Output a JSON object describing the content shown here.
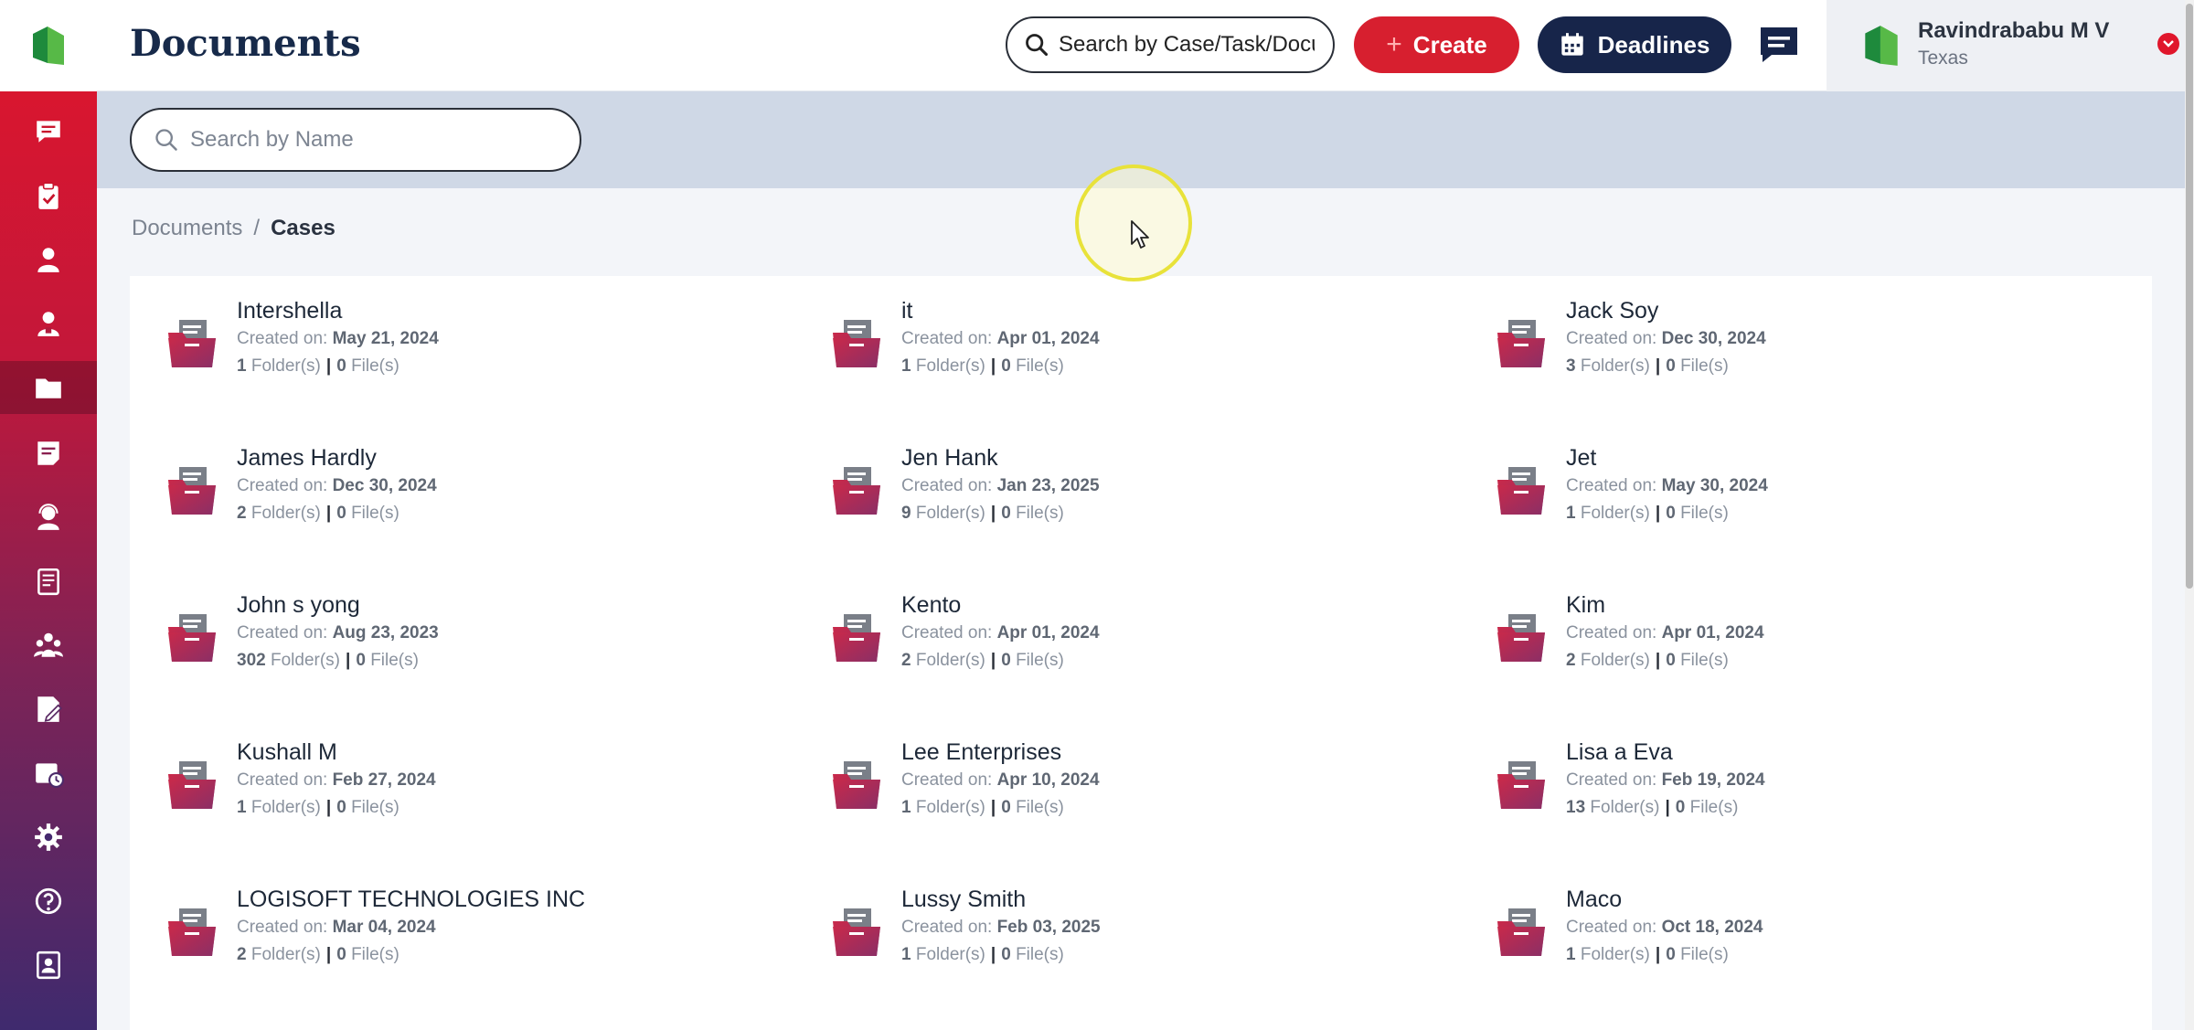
{
  "app": {
    "page_title": "Documents"
  },
  "header": {
    "search_placeholder": "Search by Case/Task/Document",
    "create_label": "Create",
    "deadlines_label": "Deadlines",
    "user_name": "Ravindrababu M V",
    "user_location": "Texas"
  },
  "band": {
    "name_search_placeholder": "Search by Name"
  },
  "breadcrumb": {
    "root": "Documents",
    "separator": "/",
    "current": "Cases"
  },
  "labels": {
    "created_on": "Created on:",
    "folders_suffix": "Folder(s)",
    "files_suffix": "File(s)",
    "divider": "|"
  },
  "sidebar": {
    "items": [
      {
        "icon": "calendar-check-icon"
      },
      {
        "icon": "chat-icon"
      },
      {
        "icon": "clipboard-check-icon"
      },
      {
        "icon": "user-icon"
      },
      {
        "icon": "contact-icon"
      },
      {
        "icon": "folder-icon",
        "active": true
      },
      {
        "icon": "notes-icon"
      },
      {
        "icon": "support-agent-icon"
      },
      {
        "icon": "book-icon"
      },
      {
        "icon": "team-icon"
      },
      {
        "icon": "edit-document-icon"
      },
      {
        "icon": "calendar-clock-icon"
      },
      {
        "icon": "gear-icon"
      },
      {
        "icon": "help-icon"
      },
      {
        "icon": "contacts-book-icon"
      }
    ]
  },
  "folders": [
    {
      "name": "Intershella",
      "created": "May 21, 2024",
      "folders": "1",
      "files": "0"
    },
    {
      "name": "it",
      "created": "Apr 01, 2024",
      "folders": "1",
      "files": "0"
    },
    {
      "name": "Jack Soy",
      "created": "Dec 30, 2024",
      "folders": "3",
      "files": "0"
    },
    {
      "name": "James Hardly",
      "created": "Dec 30, 2024",
      "folders": "2",
      "files": "0"
    },
    {
      "name": "Jen Hank",
      "created": "Jan 23, 2025",
      "folders": "9",
      "files": "0"
    },
    {
      "name": "Jet",
      "created": "May 30, 2024",
      "folders": "1",
      "files": "0"
    },
    {
      "name": "John s yong",
      "created": "Aug 23, 2023",
      "folders": "302",
      "files": "0"
    },
    {
      "name": "Kento",
      "created": "Apr 01, 2024",
      "folders": "2",
      "files": "0"
    },
    {
      "name": "Kim",
      "created": "Apr 01, 2024",
      "folders": "2",
      "files": "0"
    },
    {
      "name": "Kushall M",
      "created": "Feb 27, 2024",
      "folders": "1",
      "files": "0"
    },
    {
      "name": "Lee Enterprises",
      "created": "Apr 10, 2024",
      "folders": "1",
      "files": "0"
    },
    {
      "name": "Lisa a Eva",
      "created": "Feb 19, 2024",
      "folders": "13",
      "files": "0"
    },
    {
      "name": "LOGISOFT TECHNOLOGIES INC",
      "created": "Mar 04, 2024",
      "folders": "2",
      "files": "0"
    },
    {
      "name": "Lussy Smith",
      "created": "Feb 03, 2025",
      "folders": "1",
      "files": "0"
    },
    {
      "name": "Maco",
      "created": "Oct 18, 2024",
      "folders": "1",
      "files": "0"
    }
  ]
}
